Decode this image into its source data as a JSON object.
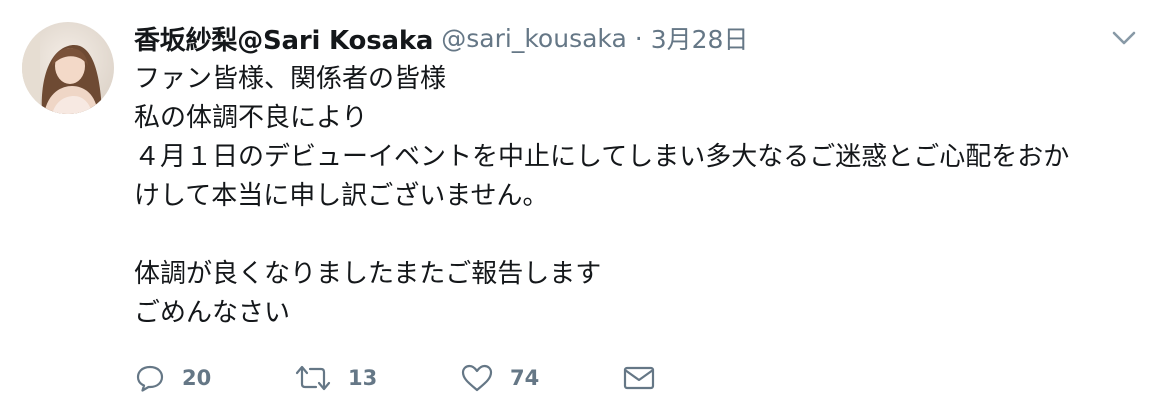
{
  "tweet": {
    "display_name": "香坂紗梨@Sari Kosaka",
    "handle": "@sari_kousaka",
    "separator": "·",
    "date": "3月28日",
    "lines": [
      "ファン皆様、関係者の皆様",
      "私の体調不良により",
      "４月１日のデビューイベントを中止にしてしまい多大なるご迷惑とご心配をおか",
      "けして本当に申し訳ございません。",
      "",
      "体調が良くなりましたまたご報告します",
      "ごめんなさい"
    ],
    "stats": {
      "replies": "20",
      "retweets": "13",
      "likes": "74"
    }
  },
  "icons": {
    "caret": "chevron-down-icon",
    "reply": "reply-icon",
    "retweet": "retweet-icon",
    "like": "heart-icon",
    "dm": "envelope-icon"
  },
  "colors": {
    "text": "#14171a",
    "secondary": "#657786"
  }
}
